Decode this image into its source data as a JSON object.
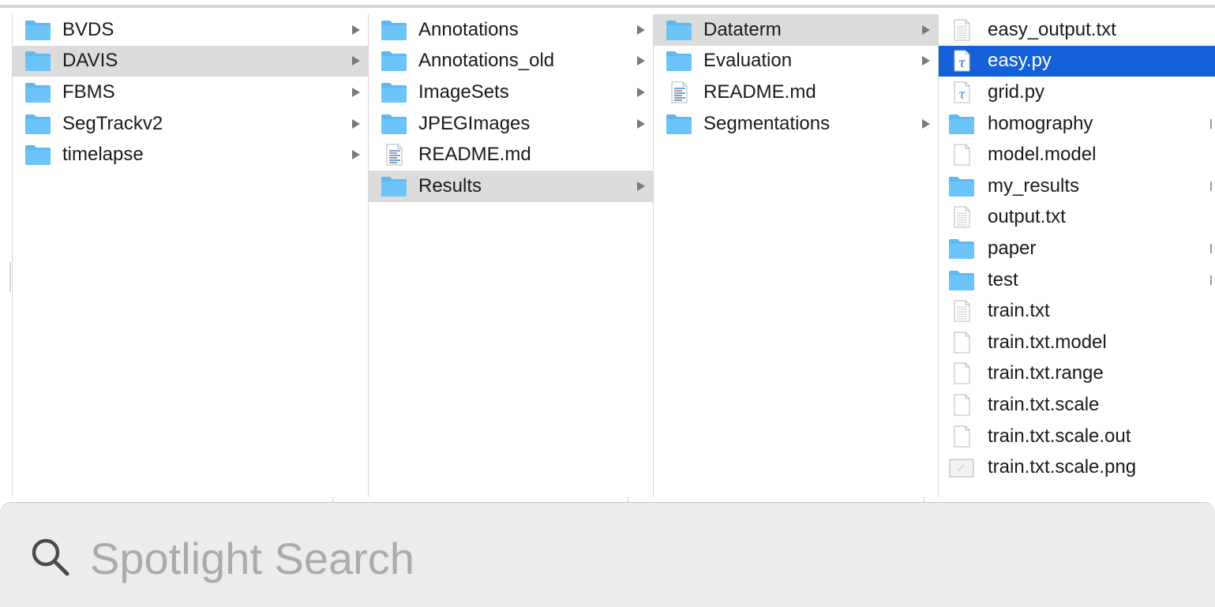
{
  "columns": [
    {
      "items": [
        {
          "label": "BVDS",
          "icon": "folder-icon",
          "has_children": true,
          "state": "none"
        },
        {
          "label": "DAVIS",
          "icon": "folder-icon",
          "has_children": true,
          "state": "path"
        },
        {
          "label": "FBMS",
          "icon": "folder-icon",
          "has_children": true,
          "state": "none"
        },
        {
          "label": "SegTrackv2",
          "icon": "folder-icon",
          "has_children": true,
          "state": "none"
        },
        {
          "label": "timelapse",
          "icon": "folder-icon",
          "has_children": true,
          "state": "none"
        }
      ]
    },
    {
      "items": [
        {
          "label": "Annotations",
          "icon": "folder-icon",
          "has_children": true,
          "state": "none"
        },
        {
          "label": "Annotations_old",
          "icon": "folder-icon",
          "has_children": true,
          "state": "none"
        },
        {
          "label": "ImageSets",
          "icon": "folder-icon",
          "has_children": true,
          "state": "none"
        },
        {
          "label": "JPEGImages",
          "icon": "folder-icon",
          "has_children": true,
          "state": "none"
        },
        {
          "label": "README.md",
          "icon": "markdown-file-icon",
          "has_children": false,
          "state": "none"
        },
        {
          "label": "Results",
          "icon": "folder-icon",
          "has_children": true,
          "state": "path"
        }
      ]
    },
    {
      "items": [
        {
          "label": "Dataterm",
          "icon": "folder-icon",
          "has_children": true,
          "state": "path"
        },
        {
          "label": "Evaluation",
          "icon": "folder-icon",
          "has_children": true,
          "state": "none"
        },
        {
          "label": "README.md",
          "icon": "markdown-file-icon",
          "has_children": false,
          "state": "none"
        },
        {
          "label": "Segmentations",
          "icon": "folder-icon",
          "has_children": true,
          "state": "none"
        }
      ]
    },
    {
      "items": [
        {
          "label": "easy_output.txt",
          "icon": "text-file-icon",
          "has_children": false,
          "state": "none"
        },
        {
          "label": "easy.py",
          "icon": "python-file-icon",
          "has_children": false,
          "state": "selected"
        },
        {
          "label": "grid.py",
          "icon": "python-file-icon",
          "has_children": false,
          "state": "none"
        },
        {
          "label": "homography",
          "icon": "folder-icon",
          "has_children": true,
          "state": "none"
        },
        {
          "label": "model.model",
          "icon": "blank-file-icon",
          "has_children": false,
          "state": "none"
        },
        {
          "label": "my_results",
          "icon": "folder-icon",
          "has_children": true,
          "state": "none"
        },
        {
          "label": "output.txt",
          "icon": "text-file-icon",
          "has_children": false,
          "state": "none"
        },
        {
          "label": "paper",
          "icon": "folder-icon",
          "has_children": true,
          "state": "none"
        },
        {
          "label": "test",
          "icon": "folder-icon",
          "has_children": true,
          "state": "none"
        },
        {
          "label": "train.txt",
          "icon": "text-file-icon",
          "has_children": false,
          "state": "none"
        },
        {
          "label": "train.txt.model",
          "icon": "blank-file-icon",
          "has_children": false,
          "state": "none"
        },
        {
          "label": "train.txt.range",
          "icon": "blank-file-icon",
          "has_children": false,
          "state": "none"
        },
        {
          "label": "train.txt.scale",
          "icon": "blank-file-icon",
          "has_children": false,
          "state": "none"
        },
        {
          "label": "train.txt.scale.out",
          "icon": "blank-file-icon",
          "has_children": false,
          "state": "none"
        },
        {
          "label": "train.txt.scale.png",
          "icon": "image-file-icon",
          "has_children": false,
          "state": "none"
        }
      ]
    }
  ],
  "spotlight": {
    "placeholder": "Spotlight Search",
    "value": "",
    "icon": "search-icon"
  },
  "colors": {
    "selection_blue": "#1360d8",
    "path_gray": "#dcdcdc",
    "folder_blue": "#5fb8f2"
  }
}
